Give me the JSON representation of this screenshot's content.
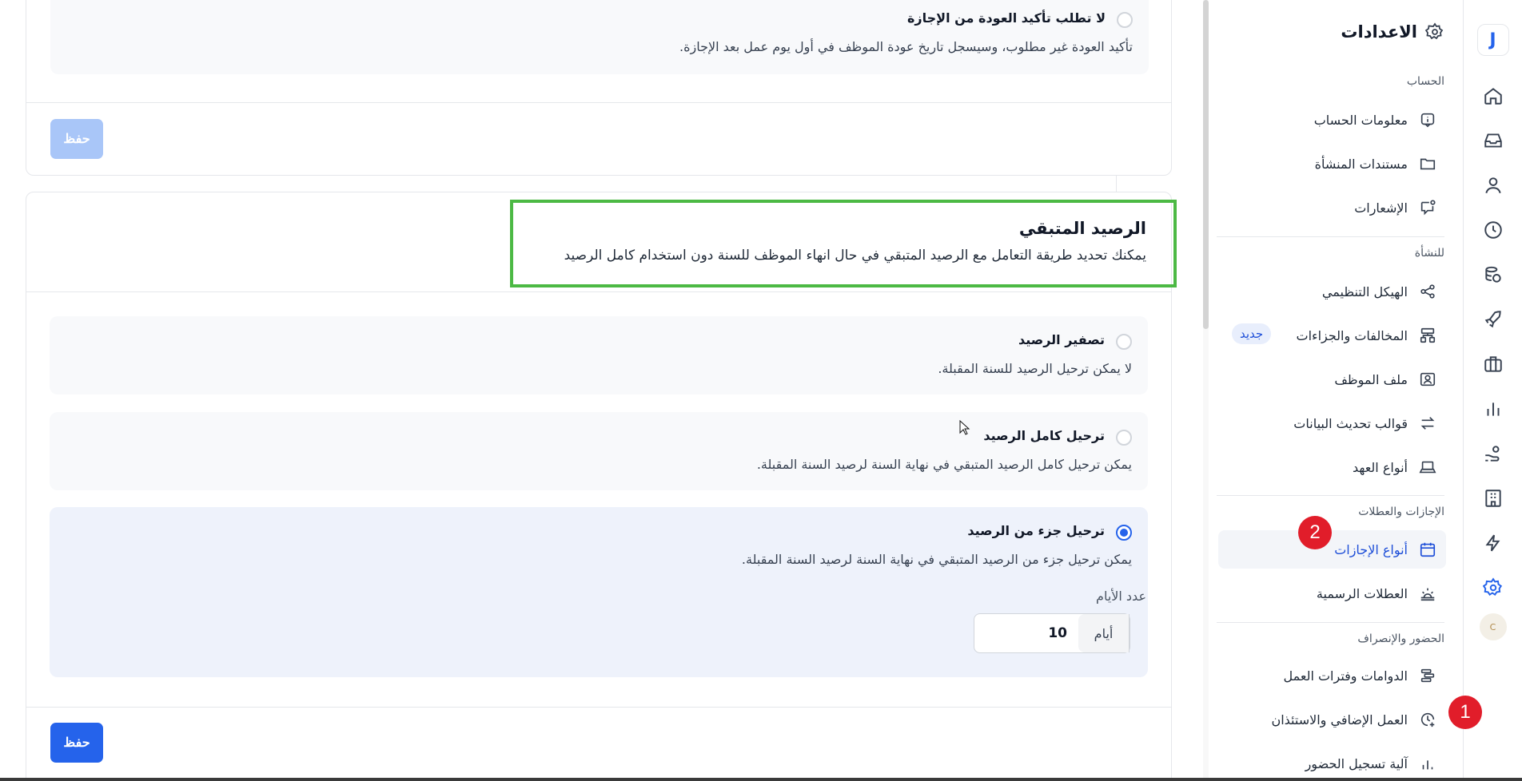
{
  "rail": {
    "logo": "J",
    "icons": [
      "home-icon",
      "inbox-icon",
      "user-icon",
      "clock-icon",
      "coins-icon",
      "rocket-icon",
      "briefcase-icon",
      "chart-icon",
      "hand-coin-icon",
      "building-icon",
      "bolt-icon",
      "gear-icon"
    ],
    "avatar_text": "C"
  },
  "panel": {
    "title": "الاعدادات",
    "sections": {
      "account": "الحساب",
      "facility": "للنشأة",
      "leaves": "الإجازات والعطلات",
      "attendance": "الحضور والإنصراف"
    },
    "items": {
      "account_info": "معلومات الحساب",
      "facility_docs": "مستندات المنشأة",
      "notifications": "الإشعارات",
      "org_structure": "الهيكل التنظيمي",
      "violations": "المخالفات والجزاءات",
      "violations_badge": "جديد",
      "employee_file": "ملف الموظف",
      "update_templates": "قوالب تحديث البيانات",
      "custody_types": "أنواع العهد",
      "leave_types": "أنواع الإجازات",
      "official_holidays": "العطلات الرسمية",
      "shifts": "الدوامات وفترات العمل",
      "overtime": "العمل الإضافي والاستئذان",
      "attendance_mechanism": "آلية تسجيل الحضور"
    }
  },
  "top_card": {
    "option_title": "لا تطلب تأكيد العودة من الإجازة",
    "option_desc": "تأكيد العودة غير مطلوب، وسيسجل تاريخ عودة الموظف في أول يوم عمل بعد الإجازة.",
    "save_label": "حفظ"
  },
  "balance_card": {
    "title": "الرصيد المتبقي",
    "description": "يمكنك تحديد طريقة التعامل مع الرصيد المتبقي في حال انهاء الموظف للسنة دون استخدام كامل الرصيد",
    "options": [
      {
        "title": "تصفير الرصيد",
        "desc": "لا يمكن ترحيل الرصيد للسنة المقبلة.",
        "selected": false
      },
      {
        "title": "ترحيل كامل الرصيد",
        "desc": "يمكن ترحيل كامل الرصيد المتبقي في نهاية السنة لرصيد السنة المقبلة.",
        "selected": false
      },
      {
        "title": "ترحيل جزء من الرصيد",
        "desc": "يمكن ترحيل جزء من الرصيد المتبقي في نهاية السنة لرصيد السنة المقبلة.",
        "selected": true
      }
    ],
    "days_label": "عدد الأيام",
    "days_value": "10",
    "days_unit": "أيام",
    "save_label": "حفظ"
  },
  "annotations": {
    "step1": "1",
    "step2": "2"
  },
  "colors": {
    "accent": "#2563eb",
    "highlight": "#4cb944",
    "marker": "#e11d2a"
  }
}
